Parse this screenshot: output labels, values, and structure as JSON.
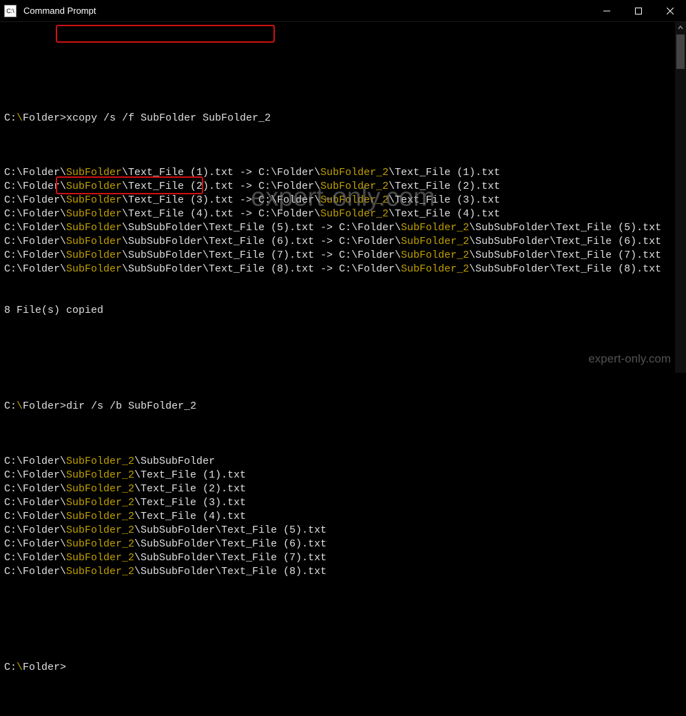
{
  "window": {
    "title": "Command Prompt"
  },
  "colors": {
    "highlight": "#c0a000",
    "box_border": "#d01010"
  },
  "prompts": {
    "p1_pre": "C:",
    "p1_sep": "\\",
    "p1_dir": "Folder",
    "p1_end": ">"
  },
  "commands": {
    "xcopy": "xcopy /s /f SubFolder SubFolder_2",
    "dir": "dir /s /b SubFolder_2"
  },
  "xcopy_output": {
    "lines": [
      {
        "pre1": "C:\\Folder\\",
        "hl1": "SubFolder",
        "mid": "\\Text_File (1).txt -> C:\\Folder\\",
        "hl2": "SubFolder_2",
        "post": "\\Text_File (1).txt"
      },
      {
        "pre1": "C:\\Folder\\",
        "hl1": "SubFolder",
        "mid": "\\Text_File (2).txt -> C:\\Folder\\",
        "hl2": "SubFolder_2",
        "post": "\\Text_File (2).txt"
      },
      {
        "pre1": "C:\\Folder\\",
        "hl1": "SubFolder",
        "mid": "\\Text_File (3).txt -> C:\\Folder\\",
        "hl2": "SubFolder_2",
        "post": "\\Text_File (3).txt"
      },
      {
        "pre1": "C:\\Folder\\",
        "hl1": "SubFolder",
        "mid": "\\Text_File (4).txt -> C:\\Folder\\",
        "hl2": "SubFolder_2",
        "post": "\\Text_File (4).txt"
      },
      {
        "pre1": "C:\\Folder\\",
        "hl1": "SubFolder",
        "mid": "\\SubSubFolder\\Text_File (5).txt -> C:\\Folder\\",
        "hl2": "SubFolder_2",
        "post": "\\SubSubFolder\\Text_File (5).txt"
      },
      {
        "pre1": "C:\\Folder\\",
        "hl1": "SubFolder",
        "mid": "\\SubSubFolder\\Text_File (6).txt -> C:\\Folder\\",
        "hl2": "SubFolder_2",
        "post": "\\SubSubFolder\\Text_File (6).txt"
      },
      {
        "pre1": "C:\\Folder\\",
        "hl1": "SubFolder",
        "mid": "\\SubSubFolder\\Text_File (7).txt -> C:\\Folder\\",
        "hl2": "SubFolder_2",
        "post": "\\SubSubFolder\\Text_File (7).txt"
      },
      {
        "pre1": "C:\\Folder\\",
        "hl1": "SubFolder",
        "mid": "\\SubSubFolder\\Text_File (8).txt -> C:\\Folder\\",
        "hl2": "SubFolder_2",
        "post": "\\SubSubFolder\\Text_File (8).txt"
      }
    ],
    "summary": "8 File(s) copied"
  },
  "dir_output": {
    "lines": [
      {
        "pre": "C:\\Folder\\",
        "hl": "SubFolder_2",
        "post": "\\SubSubFolder"
      },
      {
        "pre": "C:\\Folder\\",
        "hl": "SubFolder_2",
        "post": "\\Text_File (1).txt"
      },
      {
        "pre": "C:\\Folder\\",
        "hl": "SubFolder_2",
        "post": "\\Text_File (2).txt"
      },
      {
        "pre": "C:\\Folder\\",
        "hl": "SubFolder_2",
        "post": "\\Text_File (3).txt"
      },
      {
        "pre": "C:\\Folder\\",
        "hl": "SubFolder_2",
        "post": "\\Text_File (4).txt"
      },
      {
        "pre": "C:\\Folder\\",
        "hl": "SubFolder_2",
        "post": "\\SubSubFolder\\Text_File (5).txt"
      },
      {
        "pre": "C:\\Folder\\",
        "hl": "SubFolder_2",
        "post": "\\SubSubFolder\\Text_File (6).txt"
      },
      {
        "pre": "C:\\Folder\\",
        "hl": "SubFolder_2",
        "post": "\\SubSubFolder\\Text_File (7).txt"
      },
      {
        "pre": "C:\\Folder\\",
        "hl": "SubFolder_2",
        "post": "\\SubSubFolder\\Text_File (8).txt"
      }
    ]
  },
  "watermark": {
    "center": "expert-only.com",
    "corner": "expert-only.com"
  }
}
